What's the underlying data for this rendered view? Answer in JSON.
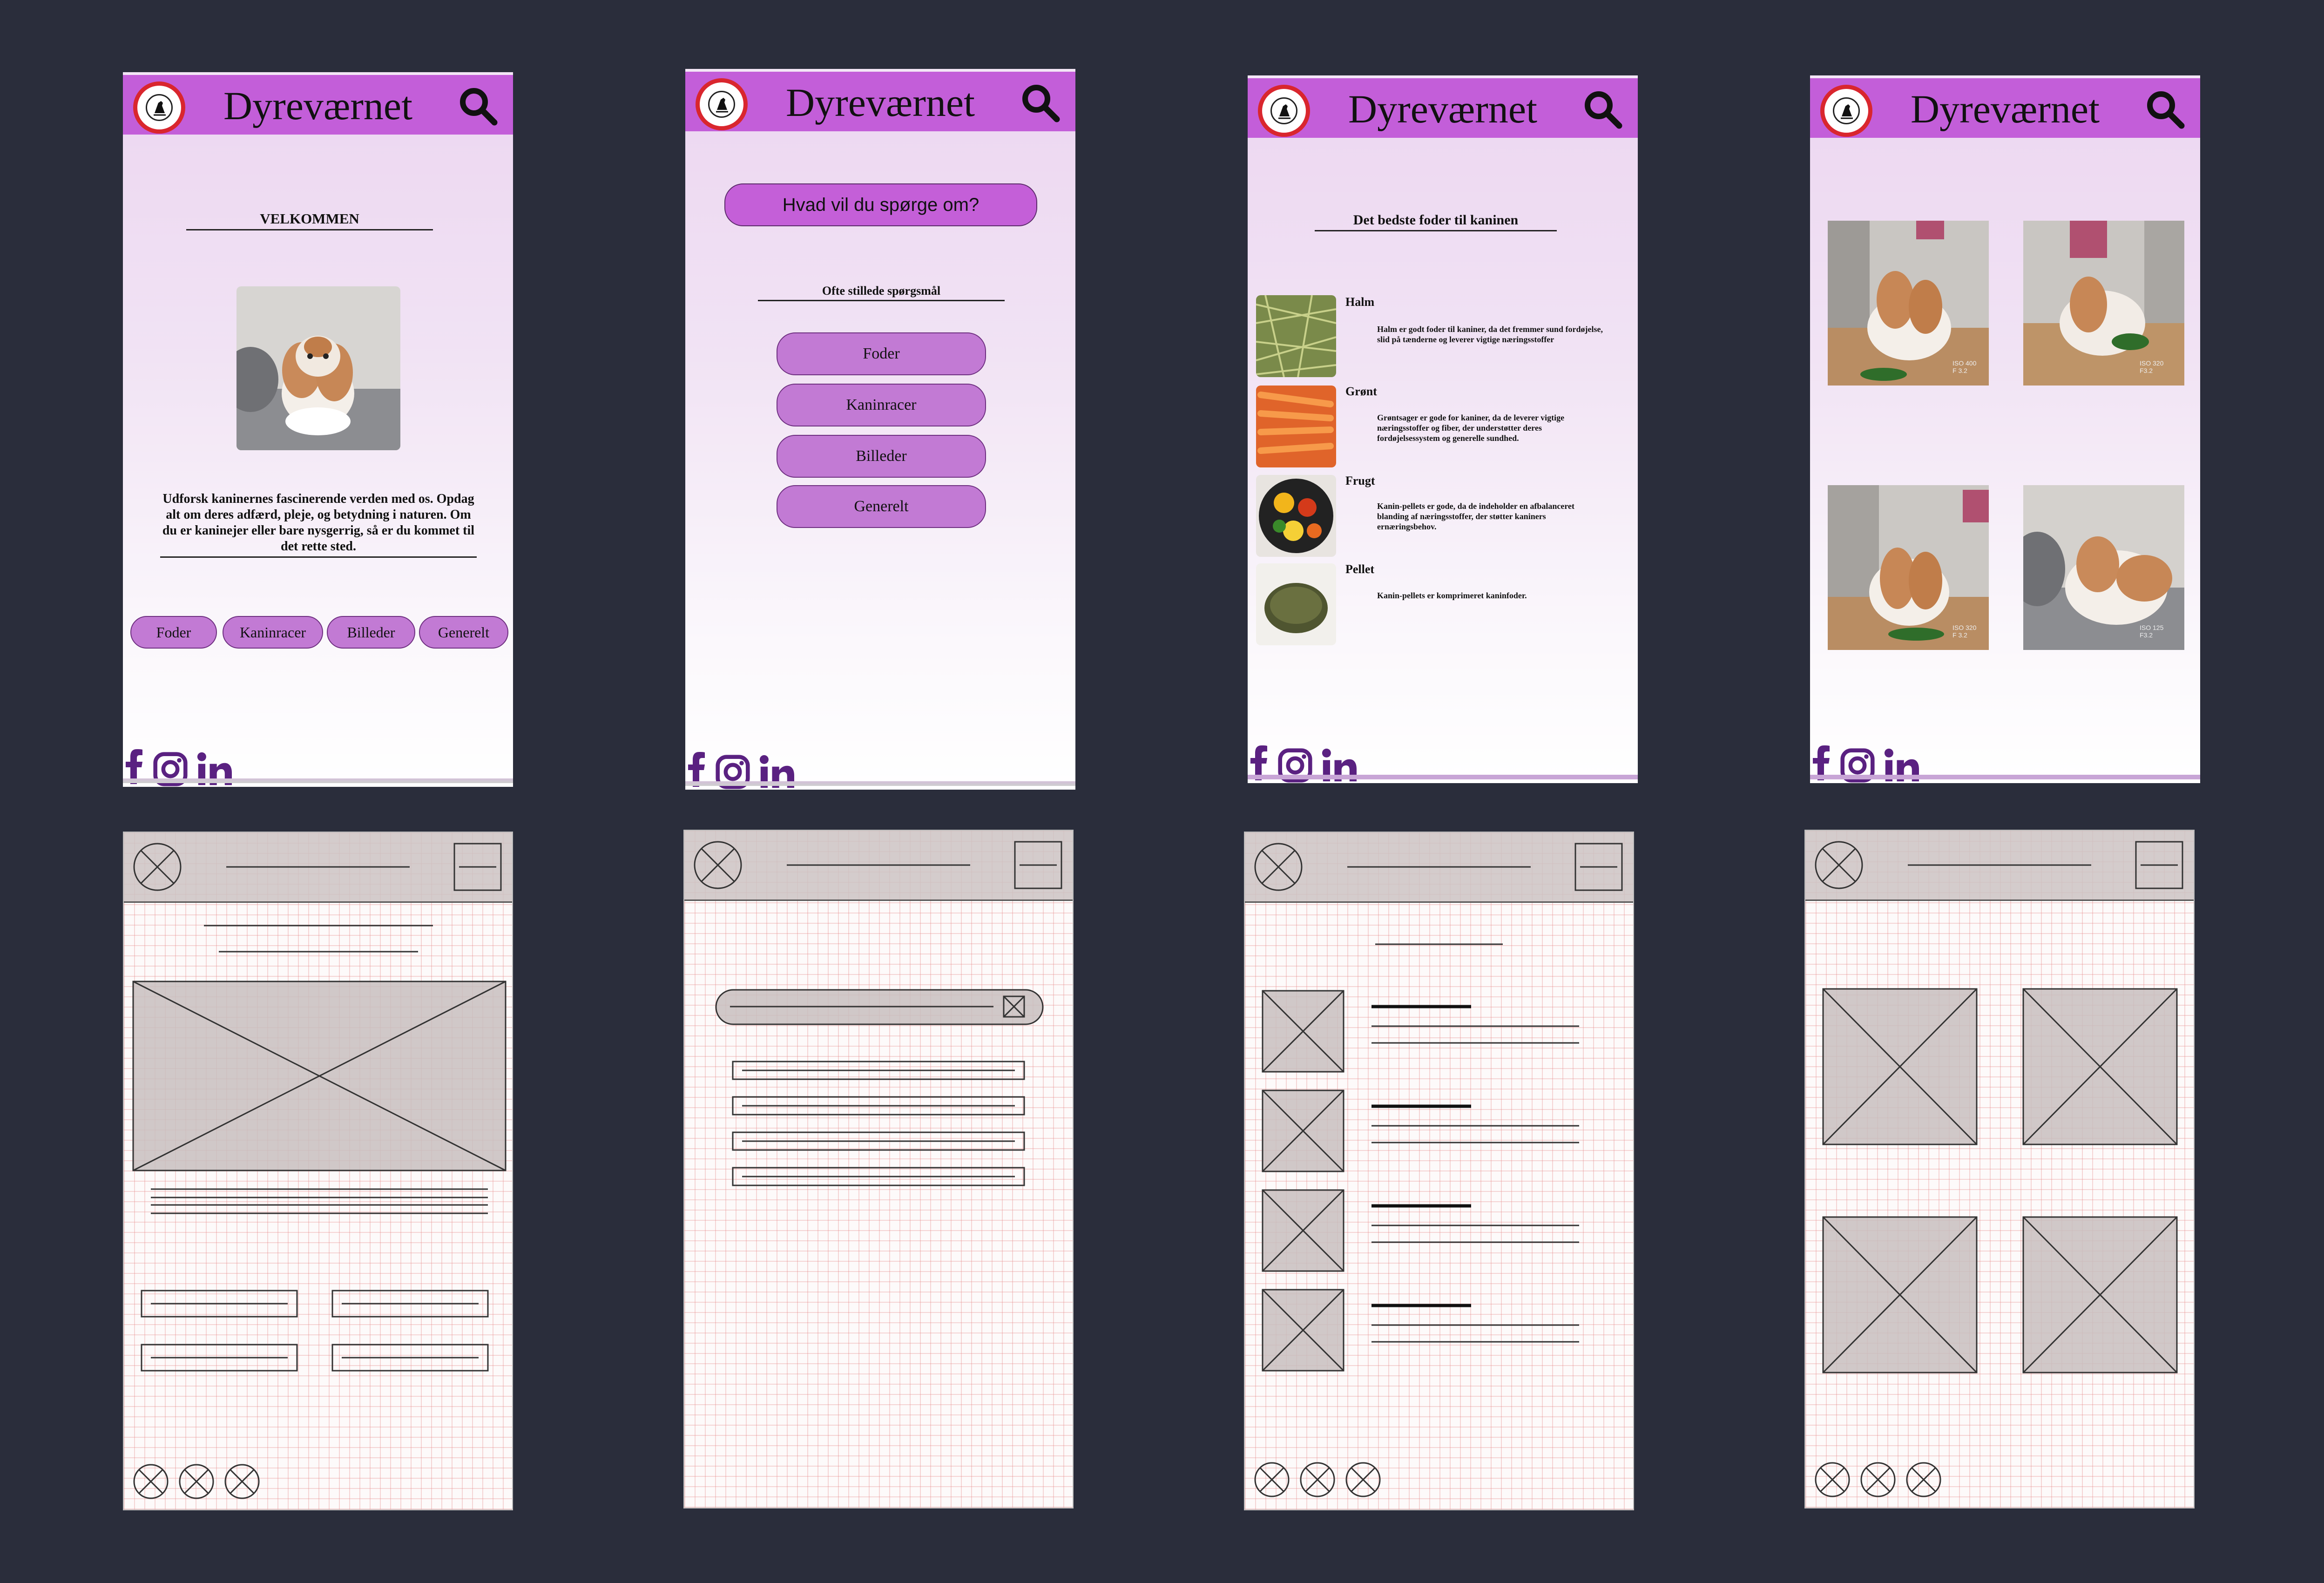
{
  "brand": "Dyreværnet",
  "home": {
    "heading": "VELKOMMEN",
    "intro": "Udforsk kaninernes fascinerende verden med os. Opdag alt om deres adfærd, pleje, og betydning i naturen. Om du er kaninejer eller bare nysgerrig, så er du kommet til det rette sted.",
    "nav": [
      "Foder",
      "Kaninracer",
      "Billeder",
      "Generelt"
    ]
  },
  "faq": {
    "search_placeholder": "Hvad vil du spørge om?",
    "heading": "Ofte stillede spørgsmål",
    "buttons": [
      "Foder",
      "Kaninracer",
      "Billeder",
      "Generelt"
    ]
  },
  "food": {
    "heading": "Det bedste foder til kaninen",
    "items": [
      {
        "name": "Halm",
        "desc": "Halm er godt foder til kaniner, da det fremmer sund fordøjelse, slid på tænderne og leverer vigtige næringsstoffer"
      },
      {
        "name": "Grønt",
        "desc": "Grøntsager er gode for kaniner, da de leverer vigtige næringsstoffer og fiber, der understøtter deres fordøjelsessystem og generelle sundhed."
      },
      {
        "name": "Frugt",
        "desc": "Kanin-pellets er gode, da de indeholder en afbalanceret blanding af næringsstoffer, der støtter kaniners ernæringsbehov."
      },
      {
        "name": "Pellet",
        "desc": "Kanin-pellets er komprimeret kaninfoder."
      }
    ]
  },
  "gallery": {
    "exif": [
      {
        "iso": "ISO 400",
        "f": "F 3.2"
      },
      {
        "iso": "ISO 320",
        "f": "F3.2"
      },
      {
        "iso": "ISO 320",
        "f": "F 3.2"
      },
      {
        "iso": "ISO 125",
        "f": "F3.2"
      }
    ]
  },
  "colors": {
    "header": "#c35ed9",
    "pill": "#c27ad4",
    "social": "#5a2181",
    "background": "#2a2d3b"
  }
}
